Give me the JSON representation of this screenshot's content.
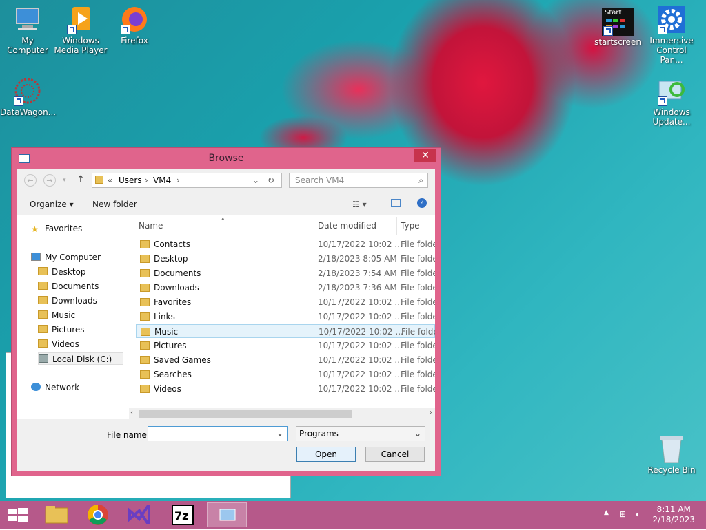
{
  "desktop": {
    "icons": [
      {
        "label": "My Computer"
      },
      {
        "label": "Windows Media Player"
      },
      {
        "label": "Firefox"
      },
      {
        "label": "DataWagon..."
      },
      {
        "label": "startscreen"
      },
      {
        "label": "Immersive Control Pan..."
      },
      {
        "label": "Windows Update..."
      },
      {
        "label": "Recycle Bin"
      }
    ],
    "start_tile_text": "Start"
  },
  "dialog": {
    "title": "Browse",
    "close": "✕",
    "address": {
      "prefix": "«",
      "segments": [
        "Users",
        "VM4"
      ]
    },
    "search_placeholder": "Search VM4",
    "toolbar": {
      "organize": "Organize",
      "new_folder": "New folder"
    },
    "nav": {
      "favorites": "Favorites",
      "my_computer": "My Computer",
      "children": [
        "Desktop",
        "Documents",
        "Downloads",
        "Music",
        "Pictures",
        "Videos",
        "Local Disk (C:)"
      ],
      "network": "Network"
    },
    "columns": {
      "name": "Name",
      "date": "Date modified",
      "type": "Type"
    },
    "rows": [
      {
        "name": "Contacts",
        "date": "10/17/2022 10:02 ...",
        "type": "File folder"
      },
      {
        "name": "Desktop",
        "date": "2/18/2023 8:05 AM",
        "type": "File folder"
      },
      {
        "name": "Documents",
        "date": "2/18/2023 7:54 AM",
        "type": "File folder"
      },
      {
        "name": "Downloads",
        "date": "2/18/2023 7:36 AM",
        "type": "File folder"
      },
      {
        "name": "Favorites",
        "date": "10/17/2022 10:02 ...",
        "type": "File folder"
      },
      {
        "name": "Links",
        "date": "10/17/2022 10:02 ...",
        "type": "File folder"
      },
      {
        "name": "Music",
        "date": "10/17/2022 10:02 ...",
        "type": "File folder"
      },
      {
        "name": "Pictures",
        "date": "10/17/2022 10:02 ...",
        "type": "File folder"
      },
      {
        "name": "Saved Games",
        "date": "10/17/2022 10:02 ...",
        "type": "File folder"
      },
      {
        "name": "Searches",
        "date": "10/17/2022 10:02 ...",
        "type": "File folder"
      },
      {
        "name": "Videos",
        "date": "10/17/2022 10:02 ...",
        "type": "File folder"
      }
    ],
    "selected_row": "Music",
    "file_name_label": "File name:",
    "file_name_value": "",
    "file_type": "Programs",
    "open": "Open",
    "cancel": "Cancel"
  },
  "taskbar": {
    "time": "8:11 AM",
    "date": "2/18/2023",
    "apps": [
      "start-button",
      "file-explorer",
      "chrome",
      "visual-studio",
      "7zip",
      "browse-dialog"
    ]
  },
  "colors": {
    "accent": "#e0648c",
    "taskbar": "#b6598a",
    "close": "#c7334c",
    "selection": "#e5f3fb"
  }
}
